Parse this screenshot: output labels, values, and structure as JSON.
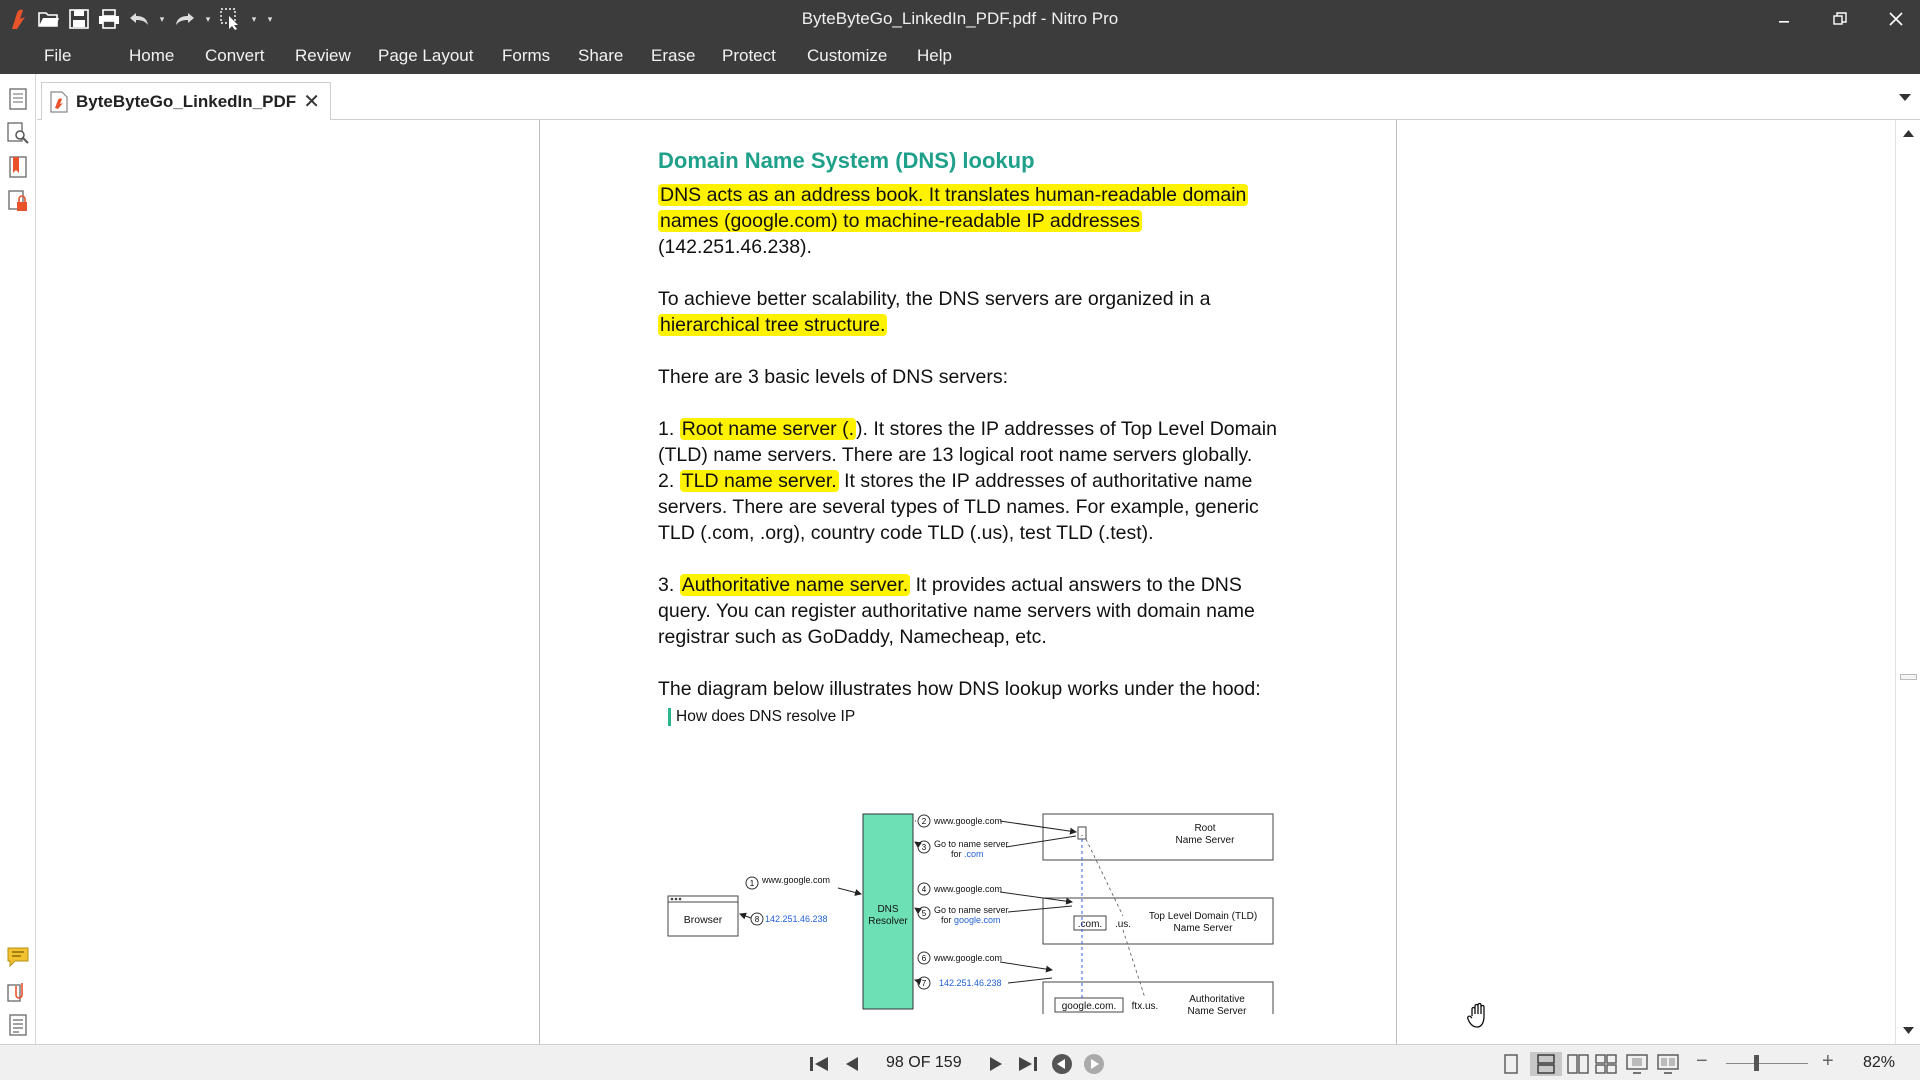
{
  "app": {
    "window_title": "ByteByteGo_LinkedIn_PDF.pdf - Nitro Pro",
    "accent": "#e8532b"
  },
  "quick_access": [
    "open-folder-icon",
    "save-icon",
    "print-icon",
    "undo-icon",
    "redo-icon",
    "select-tool-icon",
    "customize-qat-icon"
  ],
  "menu": [
    "File",
    "Home",
    "Convert",
    "Review",
    "Page Layout",
    "Forms",
    "Share",
    "Erase",
    "Protect",
    "Customize",
    "Help"
  ],
  "left_rail": {
    "top": [
      "pages-panel-icon",
      "find-panel-icon",
      "bookmarks-panel-icon",
      "security-panel-icon"
    ],
    "bottom": [
      "comments-panel-icon",
      "attachments-panel-icon",
      "output-panel-icon"
    ]
  },
  "tab": {
    "label": "ByteByteGo_LinkedIn_PDF",
    "close": "✕"
  },
  "document": {
    "heading": "Domain Name System (DNS) lookup",
    "para1_hl_line1": "DNS acts as an address book. It translates human-readable domain",
    "para1_hl_line2": "names (google.com) to machine-readable IP addresses",
    "para1_tail": "(142.251.46.238).",
    "para2_text": "To achieve better scalability, the DNS servers are organized in a",
    "para2_hl": "hierarchical tree structure.",
    "para3": "There are 3 basic levels of DNS servers:",
    "item1_num": "1. ",
    "item1_hl": "Root name server (.",
    "item1_rest": "). It stores the IP addresses of Top Level Domain (TLD) name servers. There are 13 logical root name servers globally.",
    "item2_num": "2. ",
    "item2_hl": "TLD name server.",
    "item2_rest": " It stores the IP addresses of authoritative name servers. There are several types of TLD names. For example, generic TLD (.com, .org), country code TLD (.us), test TLD (.test).",
    "item3_num": "3. ",
    "item3_hl": "Authoritative name server.",
    "item3_rest": " It provides actual answers to the DNS query. You can register authoritative name servers with domain name registrar such as GoDaddy, Namecheap, etc.",
    "para_diagram_intro": "The diagram below illustrates how DNS lookup works under the hood:",
    "diagram_caption": "How does DNS resolve IP"
  },
  "diagram": {
    "browser": "Browser",
    "resolver_line1": "DNS",
    "resolver_line2": "Resolver",
    "root_line1": "Root",
    "root_line2": "Name Server",
    "root_dot": ".",
    "tld_line1": "Top Level Domain (TLD)",
    "tld_line2": "Name Server",
    "tld_com": ".com.",
    "tld_us": ".us.",
    "auth_line1": "Authoritative",
    "auth_line2": "Name Server",
    "auth_google": "google.com.",
    "auth_ftx": "ftx.us.",
    "step1": "www.google.com",
    "step2": "www.google.com",
    "step3a": "Go to name server",
    "step3b_pre": "for ",
    "step3b_link": ".com",
    "step4": "www.google.com",
    "step5a": "Go to name server",
    "step5b_pre": "for ",
    "step5b_link": "google.com",
    "step6": "www.google.com",
    "step7": "142.251.46.238",
    "step8": "142.251.46.238",
    "n1": "1",
    "n2": "2",
    "n3": "3",
    "n4": "4",
    "n5": "5",
    "n6": "6",
    "n7": "7",
    "n8": "8",
    "resolver_color": "#6ee0b6",
    "link_color": "#1f5fd6"
  },
  "status": {
    "page_indicator": "98 OF 159",
    "zoom": "82%",
    "zoom_minus": "−",
    "zoom_plus": "+"
  }
}
